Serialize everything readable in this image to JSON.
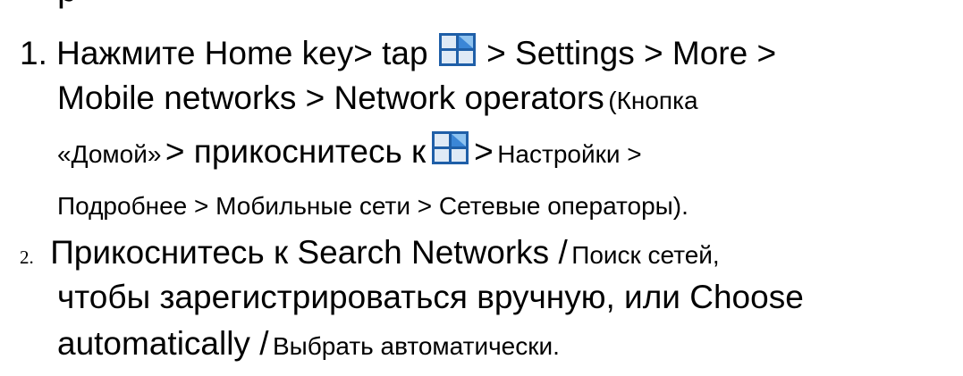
{
  "heading_fragment": "p",
  "icon": "app-grid-icon",
  "step1": {
    "number": "1.",
    "text_a": "Нажмите Home key> tap",
    "text_b": "> Settings > More >",
    "line2_en": "Mobile networks > Network operators",
    "line2_ru": "(Кнопка",
    "line3_ru_a": "«Домой»",
    "line3_mid": "> прикоснитесь к",
    "line3_gt": ">",
    "line3_ru_b": "Настройки >",
    "line4": "Подробнее > Мобильные сети > Сетевые операторы)."
  },
  "step2": {
    "number": "2.",
    "line1_a": "Прикоснитесь к Search Networks /",
    "line1_b": "Поиск сетей,",
    "line2": "чтобы зарегистрироваться вручную, или Choose",
    "line3_a": "automatically /",
    "line3_b": "Выбрать автоматически."
  },
  "colors": {
    "text": "#000000",
    "icon_blue": "#1f5fa8",
    "icon_light": "#dfeaf6"
  }
}
